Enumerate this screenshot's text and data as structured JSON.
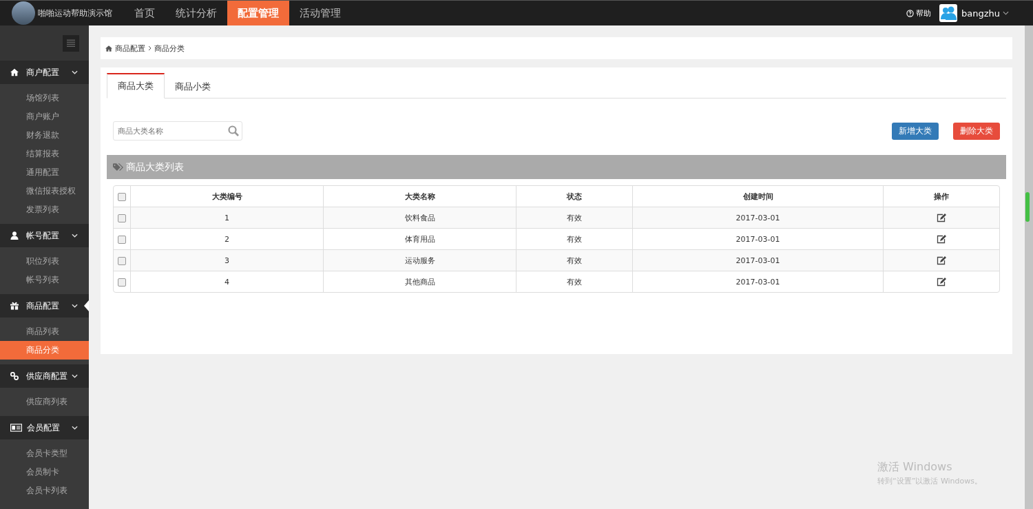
{
  "brand": {
    "name": "啪啪运动帮助演示馆"
  },
  "top_nav": [
    {
      "label": "首页",
      "selected": false
    },
    {
      "label": "统计分析",
      "selected": false
    },
    {
      "label": "配置管理",
      "selected": true
    },
    {
      "label": "活动管理",
      "selected": false
    }
  ],
  "user_bar": {
    "help": "帮助",
    "username": "bangzhu"
  },
  "sidebar": {
    "groups": [
      {
        "label": "商户配置",
        "expanded": true,
        "current": false,
        "items": [
          {
            "label": "场馆列表",
            "selected": false
          },
          {
            "label": "商户账户",
            "selected": false
          },
          {
            "label": "财务退款",
            "selected": false
          },
          {
            "label": "结算报表",
            "selected": false
          },
          {
            "label": "通用配置",
            "selected": false
          },
          {
            "label": "微信报表授权",
            "selected": false
          },
          {
            "label": "发票列表",
            "selected": false
          }
        ]
      },
      {
        "label": "帐号配置",
        "expanded": true,
        "current": false,
        "items": [
          {
            "label": "职位列表",
            "selected": false
          },
          {
            "label": "帐号列表",
            "selected": false
          }
        ]
      },
      {
        "label": "商品配置",
        "expanded": true,
        "current": true,
        "items": [
          {
            "label": "商品列表",
            "selected": false
          },
          {
            "label": "商品分类",
            "selected": true
          }
        ]
      },
      {
        "label": "供应商配置",
        "expanded": true,
        "current": false,
        "items": [
          {
            "label": "供应商列表",
            "selected": false
          }
        ]
      },
      {
        "label": "会员配置",
        "expanded": true,
        "current": false,
        "items": [
          {
            "label": "会员卡类型",
            "selected": false
          },
          {
            "label": "会员制卡",
            "selected": false
          },
          {
            "label": "会员卡列表",
            "selected": false
          }
        ]
      }
    ]
  },
  "breadcrumb": [
    "商品配置",
    "商品分类"
  ],
  "tabs": [
    {
      "label": "商品大类",
      "selected": true
    },
    {
      "label": "商品小类",
      "selected": false
    }
  ],
  "search": {
    "placeholder": "商品大类名称"
  },
  "buttons": [
    {
      "label": "新增大类",
      "kind": "primary"
    },
    {
      "label": "删除大类",
      "kind": "danger"
    }
  ],
  "list_title": "商品大类列表",
  "table": {
    "header_checked": false,
    "columns": [
      "大类编号",
      "大类名称",
      "状态",
      "创建时间",
      "操作"
    ],
    "rows": [
      {
        "checked": false,
        "cells": [
          "1",
          "饮料食品",
          "有效",
          "2017-03-01"
        ]
      },
      {
        "checked": false,
        "cells": [
          "2",
          "体育用品",
          "有效",
          "2017-03-01"
        ]
      },
      {
        "checked": false,
        "cells": [
          "3",
          "运动服务",
          "有效",
          "2017-03-01"
        ]
      },
      {
        "checked": false,
        "cells": [
          "4",
          "其他商品",
          "有效",
          "2017-03-01"
        ]
      }
    ]
  },
  "windows_notice": {
    "title": "激活 Windows",
    "text": "转到“设置”以激活 Windows。"
  }
}
